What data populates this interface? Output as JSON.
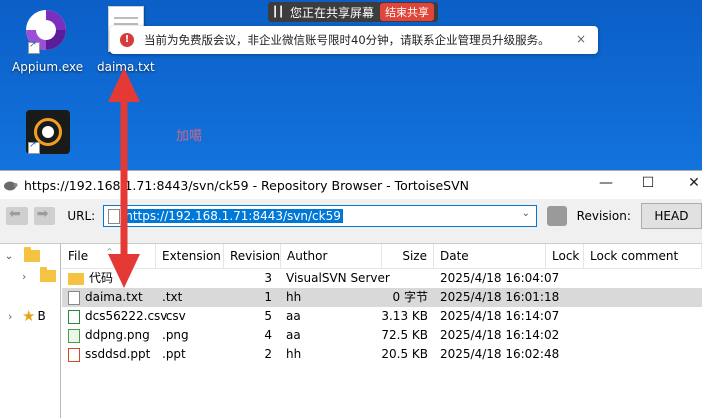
{
  "desktop": {
    "icons": [
      {
        "label": "Appium.exe"
      },
      {
        "label": "daima.txt"
      }
    ],
    "faint_label": "加噶"
  },
  "share_bar": {
    "status": "您正在共享屏幕",
    "stop_label": "结束共享"
  },
  "toast": {
    "message": "当前为免费版会议，非企业微信账号限时40分钟，请联系企业管理员升级服务。",
    "close": "×"
  },
  "window": {
    "title": "https://192.168.1.71:8443/svn/ck59 - Repository Browser - TortoiseSVN",
    "controls": {
      "minimize": "—",
      "maximize": "☐",
      "close": "✕"
    },
    "toolbar": {
      "url_label": "URL:",
      "url_value": "https://192.168.1.71:8443/svn/ck59",
      "revision_label": "Revision:",
      "revision_value": "HEAD"
    },
    "tree": {
      "items": [
        {
          "label": ""
        },
        {
          "label": ""
        },
        {
          "label": "B"
        }
      ]
    },
    "list": {
      "columns": [
        "File",
        "Extension",
        "Revision",
        "Author",
        "Size",
        "Date",
        "Lock",
        "Lock comment"
      ],
      "rows": [
        {
          "file": "代码",
          "ext": "",
          "rev": "3",
          "author": "VisualSVN Server",
          "size": "",
          "date": "2025/4/18 16:04:07",
          "icon": "folder-icon"
        },
        {
          "file": "daima.txt",
          "ext": ".txt",
          "rev": "1",
          "author": "hh",
          "size": "0 字节",
          "date": "2025/4/18 16:01:18",
          "icon": "text-file-icon"
        },
        {
          "file": "dcs56222.csv",
          "ext": ".csv",
          "rev": "5",
          "author": "aa",
          "size": "3.13 KB",
          "date": "2025/4/18 16:14:07",
          "icon": "csv-file-icon"
        },
        {
          "file": "ddpng.png",
          "ext": ".png",
          "rev": "4",
          "author": "aa",
          "size": "72.5 KB",
          "date": "2025/4/18 16:14:02",
          "icon": "png-file-icon"
        },
        {
          "file": "ssddsd.ppt",
          "ext": ".ppt",
          "rev": "2",
          "author": "hh",
          "size": "20.5 KB",
          "date": "2025/4/18 16:02:48",
          "icon": "ppt-file-icon"
        }
      ],
      "selected_row": 1
    }
  },
  "colors": {
    "desktop": "#1372dc",
    "accent": "#0078d7",
    "stop_button": "#e0453a",
    "arrow": "#e53935",
    "folder": "#f5c342"
  }
}
